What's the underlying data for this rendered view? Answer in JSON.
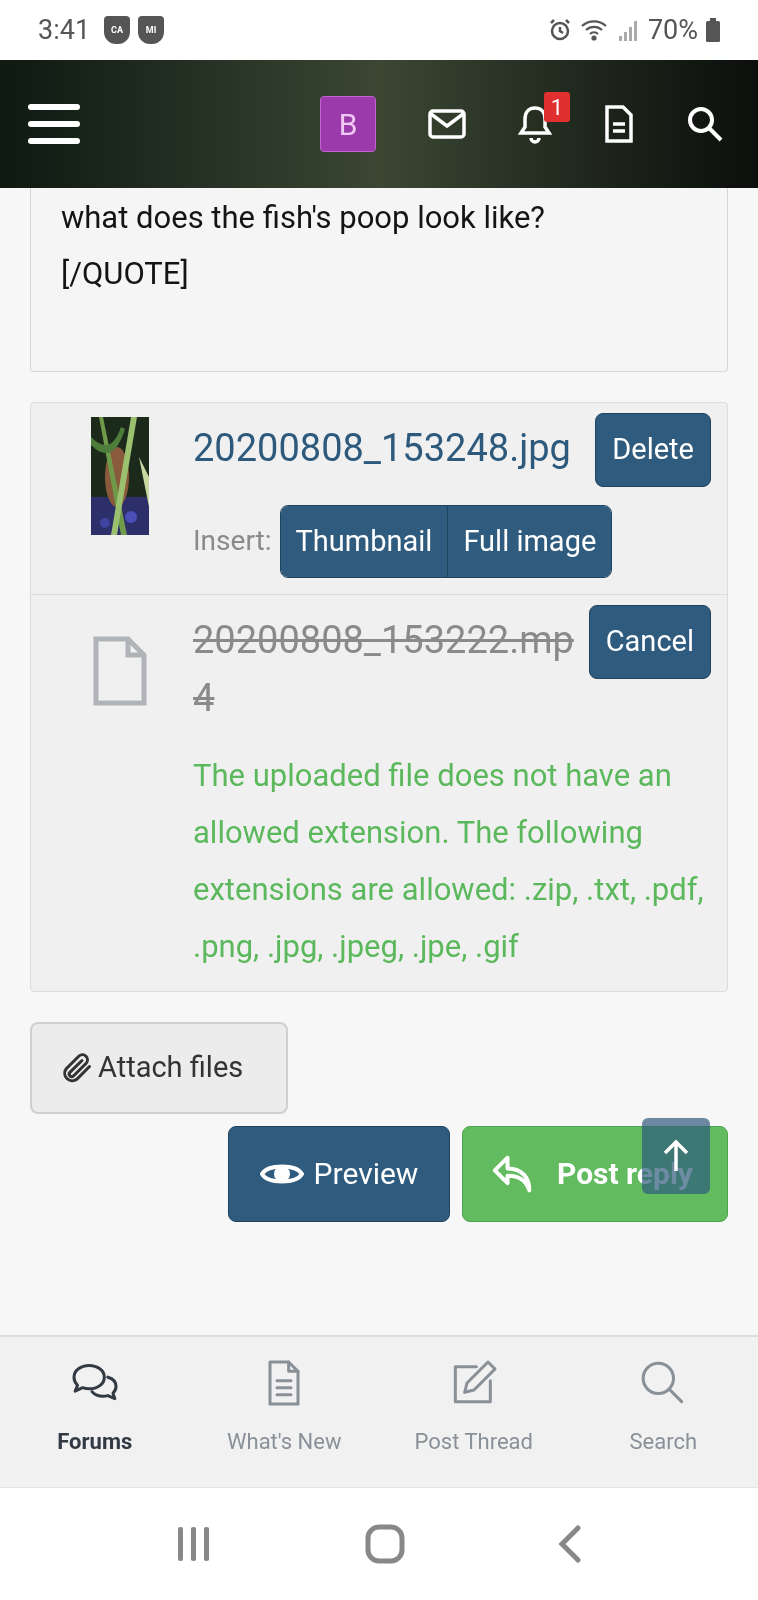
{
  "status_bar": {
    "time": "3:41",
    "badges": [
      "CA",
      "MI"
    ],
    "battery": "70%"
  },
  "header": {
    "avatar_letter": "B",
    "notification_count": "1"
  },
  "editor": {
    "lines": [
      "what does the fish's poop look like?",
      "[/QUOTE]"
    ]
  },
  "attachments": [
    {
      "filename": "20200808_153248.jpg",
      "failed": false,
      "action": "Delete",
      "insert_label": "Insert:",
      "insert_buttons": [
        "Thumbnail",
        "Full image"
      ]
    },
    {
      "kind": "file",
      "filename": "20200808_153222.mp4",
      "failed": true,
      "action": "Cancel",
      "error": "The uploaded file does not have an allowed extension. The following extensions are allowed: .zip, .txt, .pdf, .png, .jpg, .jpeg, .jpe, .gif"
    }
  ],
  "attach_button": "Attach files",
  "preview_button": "Preview",
  "submit_button": "Post reply",
  "bottom_nav": [
    {
      "label": "Forums",
      "selected": true
    },
    {
      "label": "What's New",
      "selected": false
    },
    {
      "label": "Post Thread",
      "selected": false
    },
    {
      "label": "Search",
      "selected": false
    }
  ]
}
